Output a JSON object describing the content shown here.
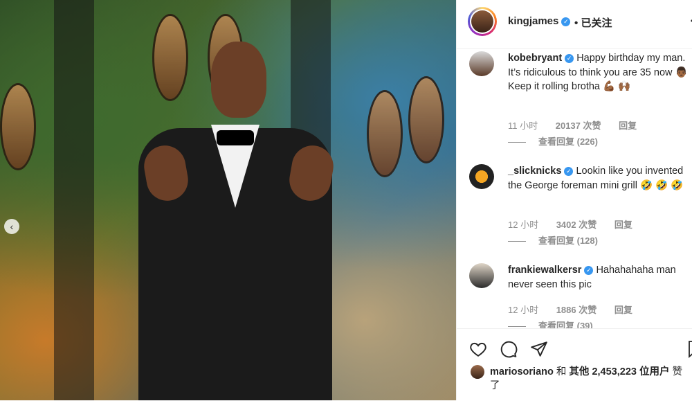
{
  "post": {
    "author": "kingjames",
    "follow_status": "已关注",
    "separator": "•"
  },
  "comments": [
    {
      "user": "kobebryant",
      "text": "Happy birthday my man. It’s ridiculous to think you are 35 now 👨🏾  Keep it rolling brotha 💪🏾 🙌🏾",
      "time": "11 小时",
      "likes": "20137 次赞",
      "reply": "回复",
      "view_replies": "查看回复 (226)"
    },
    {
      "user": "_slicknicks",
      "text": "Lookin like you invented the George foreman mini grill 🤣 🤣 🤣",
      "time": "12 小时",
      "likes": "3402 次赞",
      "reply": "回复",
      "view_replies": "查看回复 (128)"
    },
    {
      "user": "frankiewalkersr",
      "text": "Hahahahaha man never seen this pic",
      "time": "12 小时",
      "likes": "1886 次赞",
      "reply": "回复",
      "view_replies": "查看回复 (39)"
    }
  ],
  "likes_line": {
    "user": "mariosoriano",
    "connector": "和",
    "others": "其他 2,453,223 位用户",
    "suffix": "赞了"
  },
  "icons": [
    "heart-icon",
    "comment-icon",
    "share-icon",
    "bookmark-icon",
    "more-icon",
    "verified-icon"
  ],
  "colors": {
    "verified": "#3897f0",
    "meta": "#8e8e8e",
    "text": "#262626"
  }
}
